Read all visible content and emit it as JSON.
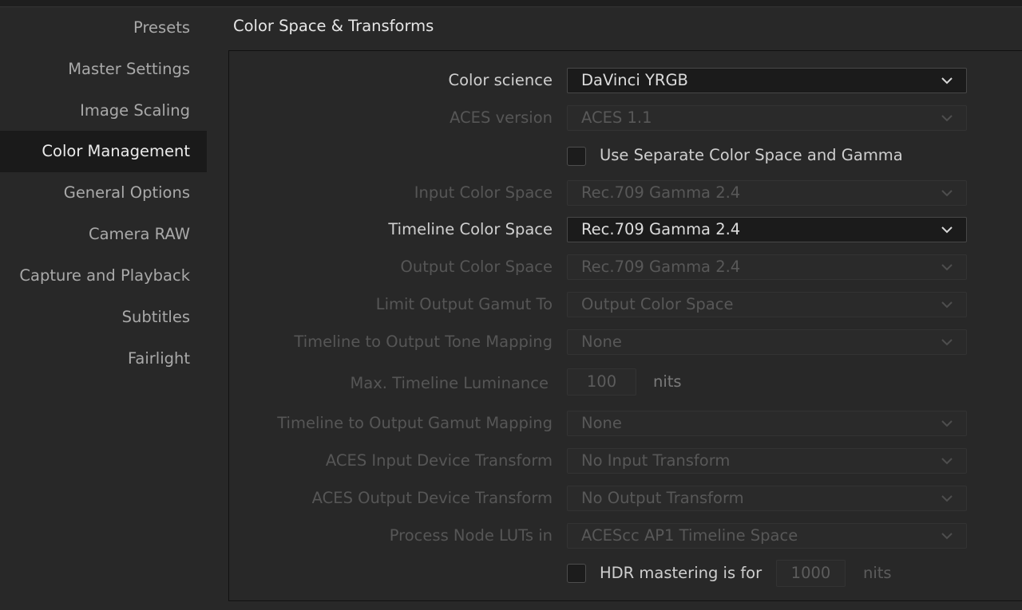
{
  "sidebar": {
    "items": [
      {
        "label": "Presets"
      },
      {
        "label": "Master Settings"
      },
      {
        "label": "Image Scaling"
      },
      {
        "label": "Color Management"
      },
      {
        "label": "General Options"
      },
      {
        "label": "Camera RAW"
      },
      {
        "label": "Capture and Playback"
      },
      {
        "label": "Subtitles"
      },
      {
        "label": "Fairlight"
      }
    ],
    "active": "Color Management"
  },
  "section": {
    "title": "Color Space & Transforms"
  },
  "fields": {
    "color_science": {
      "label": "Color science",
      "value": "DaVinci YRGB"
    },
    "aces_version": {
      "label": "ACES version",
      "value": "ACES 1.1"
    },
    "separate_cs_gamma": {
      "label": "Use Separate Color Space and Gamma",
      "checked": false
    },
    "input_color_space": {
      "label": "Input Color Space",
      "value": "Rec.709 Gamma 2.4"
    },
    "timeline_color_space": {
      "label": "Timeline Color Space",
      "value": "Rec.709 Gamma 2.4"
    },
    "output_color_space": {
      "label": "Output Color Space",
      "value": "Rec.709 Gamma 2.4"
    },
    "limit_output_gamut": {
      "label": "Limit Output Gamut To",
      "value": "Output Color Space"
    },
    "tone_mapping": {
      "label": "Timeline to Output Tone Mapping",
      "value": "None"
    },
    "max_luminance": {
      "label": "Max. Timeline Luminance",
      "value": "100",
      "unit": "nits"
    },
    "gamut_mapping": {
      "label": "Timeline to Output Gamut Mapping",
      "value": "None"
    },
    "aces_idt": {
      "label": "ACES Input Device Transform",
      "value": "No Input Transform"
    },
    "aces_odt": {
      "label": "ACES Output Device Transform",
      "value": "No Output Transform"
    },
    "process_node_luts": {
      "label": "Process Node LUTs in",
      "value": "ACEScc AP1 Timeline Space"
    },
    "hdr_mastering": {
      "label": "HDR mastering is for",
      "checked": false,
      "value": "1000",
      "unit": "nits"
    }
  },
  "icons": {
    "dropdown": "chevron-down-icon"
  },
  "colors": {
    "background": "#282828",
    "active_item_bg": "#1a1a1a",
    "enabled_text": "#cfcfcf",
    "disabled_text": "#565656"
  }
}
